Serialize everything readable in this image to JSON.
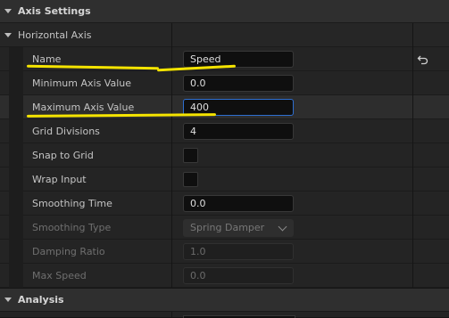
{
  "categories": {
    "axis_settings": "Axis Settings",
    "horizontal_axis": "Horizontal Axis",
    "analysis": "Analysis"
  },
  "rows": {
    "name": {
      "label": "Name",
      "value": "Speed"
    },
    "min_axis": {
      "label": "Minimum Axis Value",
      "value": "0.0"
    },
    "max_axis": {
      "label": "Maximum Axis Value",
      "value": "400"
    },
    "grid_divisions": {
      "label": "Grid Divisions",
      "value": "4"
    },
    "snap_to_grid": {
      "label": "Snap to Grid"
    },
    "wrap_input": {
      "label": "Wrap Input"
    },
    "smoothing_time": {
      "label": "Smoothing Time",
      "value": "0.0"
    },
    "smoothing_type": {
      "label": "Smoothing Type",
      "value": "Spring Damper"
    },
    "damping_ratio": {
      "label": "Damping Ratio",
      "value": "1.0"
    },
    "max_speed": {
      "label": "Max Speed",
      "value": "0.0"
    }
  },
  "icons": {
    "reset": "reset-to-default-icon",
    "expand": "chevron-down-icon"
  },
  "colors": {
    "focus_border": "#2e6ed0",
    "annotation": "#f5e400"
  }
}
